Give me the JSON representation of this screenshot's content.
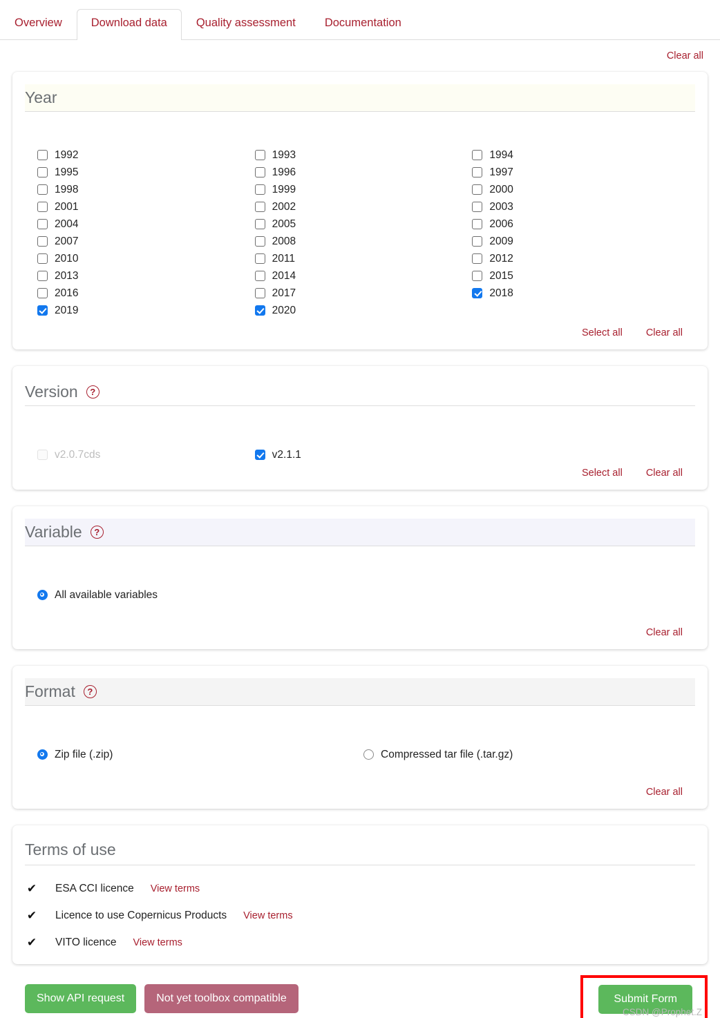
{
  "tabs": [
    {
      "label": "Overview",
      "active": false
    },
    {
      "label": "Download data",
      "active": true
    },
    {
      "label": "Quality assessment",
      "active": false
    },
    {
      "label": "Documentation",
      "active": false
    }
  ],
  "top": {
    "clear_all_label": "Clear all"
  },
  "common": {
    "select_all_label": "Select all",
    "clear_all_label": "Clear all",
    "help_icon": "question-mark-icon"
  },
  "sections": {
    "year": {
      "title": "Year",
      "options": [
        {
          "label": "1992",
          "checked": false
        },
        {
          "label": "1993",
          "checked": false
        },
        {
          "label": "1994",
          "checked": false
        },
        {
          "label": "1995",
          "checked": false
        },
        {
          "label": "1996",
          "checked": false
        },
        {
          "label": "1997",
          "checked": false
        },
        {
          "label": "1998",
          "checked": false
        },
        {
          "label": "1999",
          "checked": false
        },
        {
          "label": "2000",
          "checked": false
        },
        {
          "label": "2001",
          "checked": false
        },
        {
          "label": "2002",
          "checked": false
        },
        {
          "label": "2003",
          "checked": false
        },
        {
          "label": "2004",
          "checked": false
        },
        {
          "label": "2005",
          "checked": false
        },
        {
          "label": "2006",
          "checked": false
        },
        {
          "label": "2007",
          "checked": false
        },
        {
          "label": "2008",
          "checked": false
        },
        {
          "label": "2009",
          "checked": false
        },
        {
          "label": "2010",
          "checked": false
        },
        {
          "label": "2011",
          "checked": false
        },
        {
          "label": "2012",
          "checked": false
        },
        {
          "label": "2013",
          "checked": false
        },
        {
          "label": "2014",
          "checked": false
        },
        {
          "label": "2015",
          "checked": false
        },
        {
          "label": "2016",
          "checked": false
        },
        {
          "label": "2017",
          "checked": false
        },
        {
          "label": "2018",
          "checked": true
        },
        {
          "label": "2019",
          "checked": true
        },
        {
          "label": "2020",
          "checked": true
        }
      ]
    },
    "version": {
      "title": "Version",
      "options": [
        {
          "label": "v2.0.7cds",
          "checked": false,
          "disabled": true
        },
        {
          "label": "v2.1.1",
          "checked": true,
          "disabled": false
        }
      ]
    },
    "variable": {
      "title": "Variable",
      "options": [
        {
          "label": "All available variables",
          "checked": true
        }
      ]
    },
    "format": {
      "title": "Format",
      "options": [
        {
          "label": "Zip file (.zip)",
          "checked": true
        },
        {
          "label": "Compressed tar file (.tar.gz)",
          "checked": false
        }
      ]
    }
  },
  "terms": {
    "title": "Terms of use",
    "items": [
      {
        "name": "ESA CCI licence",
        "link": "View terms",
        "accepted": true
      },
      {
        "name": "Licence to use Copernicus Products",
        "link": "View terms",
        "accepted": true
      },
      {
        "name": "VITO licence",
        "link": "View terms",
        "accepted": true
      }
    ]
  },
  "footer": {
    "show_api_label": "Show API request",
    "toolbox_label": "Not yet toolbox compatible",
    "submit_label": "Submit Form",
    "watermark": "CSDN @Prophet.Z"
  },
  "colors": {
    "brand_red": "#a8202f",
    "checkbox_blue": "#1278ee",
    "green_button": "#5cb85c",
    "rose_button": "#b5657a",
    "highlight_box": "#ff0000"
  }
}
